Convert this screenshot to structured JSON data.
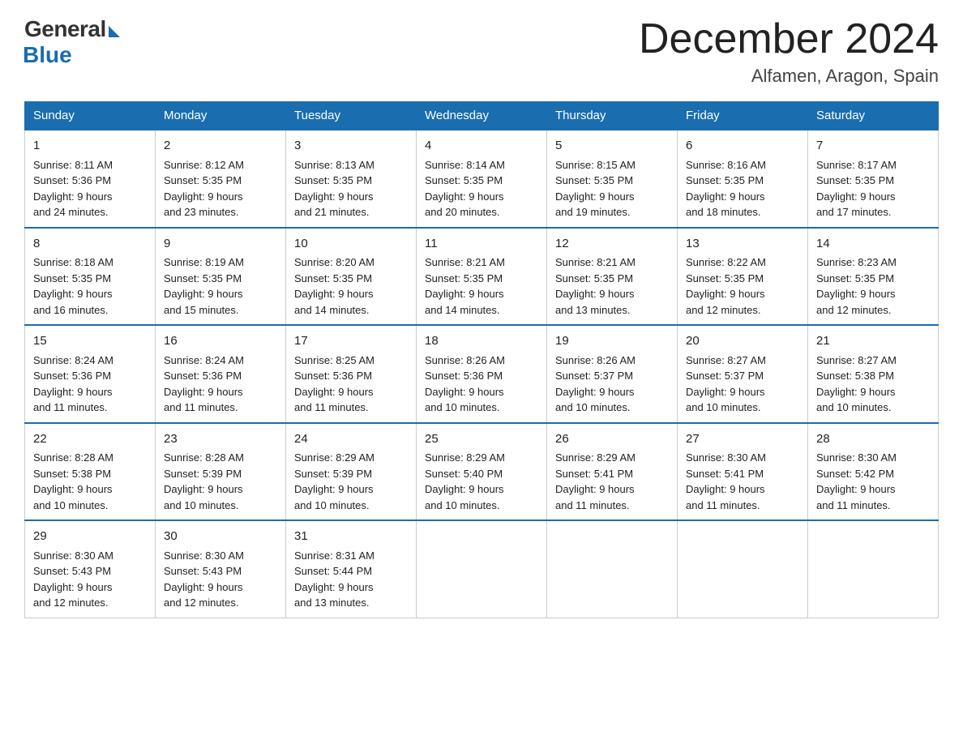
{
  "header": {
    "logo_general": "General",
    "logo_blue": "Blue",
    "month_title": "December 2024",
    "location": "Alfamen, Aragon, Spain"
  },
  "days_of_week": [
    "Sunday",
    "Monday",
    "Tuesday",
    "Wednesday",
    "Thursday",
    "Friday",
    "Saturday"
  ],
  "weeks": [
    [
      {
        "day": "1",
        "sunrise": "8:11 AM",
        "sunset": "5:36 PM",
        "daylight": "9 hours and 24 minutes."
      },
      {
        "day": "2",
        "sunrise": "8:12 AM",
        "sunset": "5:35 PM",
        "daylight": "9 hours and 23 minutes."
      },
      {
        "day": "3",
        "sunrise": "8:13 AM",
        "sunset": "5:35 PM",
        "daylight": "9 hours and 21 minutes."
      },
      {
        "day": "4",
        "sunrise": "8:14 AM",
        "sunset": "5:35 PM",
        "daylight": "9 hours and 20 minutes."
      },
      {
        "day": "5",
        "sunrise": "8:15 AM",
        "sunset": "5:35 PM",
        "daylight": "9 hours and 19 minutes."
      },
      {
        "day": "6",
        "sunrise": "8:16 AM",
        "sunset": "5:35 PM",
        "daylight": "9 hours and 18 minutes."
      },
      {
        "day": "7",
        "sunrise": "8:17 AM",
        "sunset": "5:35 PM",
        "daylight": "9 hours and 17 minutes."
      }
    ],
    [
      {
        "day": "8",
        "sunrise": "8:18 AM",
        "sunset": "5:35 PM",
        "daylight": "9 hours and 16 minutes."
      },
      {
        "day": "9",
        "sunrise": "8:19 AM",
        "sunset": "5:35 PM",
        "daylight": "9 hours and 15 minutes."
      },
      {
        "day": "10",
        "sunrise": "8:20 AM",
        "sunset": "5:35 PM",
        "daylight": "9 hours and 14 minutes."
      },
      {
        "day": "11",
        "sunrise": "8:21 AM",
        "sunset": "5:35 PM",
        "daylight": "9 hours and 14 minutes."
      },
      {
        "day": "12",
        "sunrise": "8:21 AM",
        "sunset": "5:35 PM",
        "daylight": "9 hours and 13 minutes."
      },
      {
        "day": "13",
        "sunrise": "8:22 AM",
        "sunset": "5:35 PM",
        "daylight": "9 hours and 12 minutes."
      },
      {
        "day": "14",
        "sunrise": "8:23 AM",
        "sunset": "5:35 PM",
        "daylight": "9 hours and 12 minutes."
      }
    ],
    [
      {
        "day": "15",
        "sunrise": "8:24 AM",
        "sunset": "5:36 PM",
        "daylight": "9 hours and 11 minutes."
      },
      {
        "day": "16",
        "sunrise": "8:24 AM",
        "sunset": "5:36 PM",
        "daylight": "9 hours and 11 minutes."
      },
      {
        "day": "17",
        "sunrise": "8:25 AM",
        "sunset": "5:36 PM",
        "daylight": "9 hours and 11 minutes."
      },
      {
        "day": "18",
        "sunrise": "8:26 AM",
        "sunset": "5:36 PM",
        "daylight": "9 hours and 10 minutes."
      },
      {
        "day": "19",
        "sunrise": "8:26 AM",
        "sunset": "5:37 PM",
        "daylight": "9 hours and 10 minutes."
      },
      {
        "day": "20",
        "sunrise": "8:27 AM",
        "sunset": "5:37 PM",
        "daylight": "9 hours and 10 minutes."
      },
      {
        "day": "21",
        "sunrise": "8:27 AM",
        "sunset": "5:38 PM",
        "daylight": "9 hours and 10 minutes."
      }
    ],
    [
      {
        "day": "22",
        "sunrise": "8:28 AM",
        "sunset": "5:38 PM",
        "daylight": "9 hours and 10 minutes."
      },
      {
        "day": "23",
        "sunrise": "8:28 AM",
        "sunset": "5:39 PM",
        "daylight": "9 hours and 10 minutes."
      },
      {
        "day": "24",
        "sunrise": "8:29 AM",
        "sunset": "5:39 PM",
        "daylight": "9 hours and 10 minutes."
      },
      {
        "day": "25",
        "sunrise": "8:29 AM",
        "sunset": "5:40 PM",
        "daylight": "9 hours and 10 minutes."
      },
      {
        "day": "26",
        "sunrise": "8:29 AM",
        "sunset": "5:41 PM",
        "daylight": "9 hours and 11 minutes."
      },
      {
        "day": "27",
        "sunrise": "8:30 AM",
        "sunset": "5:41 PM",
        "daylight": "9 hours and 11 minutes."
      },
      {
        "day": "28",
        "sunrise": "8:30 AM",
        "sunset": "5:42 PM",
        "daylight": "9 hours and 11 minutes."
      }
    ],
    [
      {
        "day": "29",
        "sunrise": "8:30 AM",
        "sunset": "5:43 PM",
        "daylight": "9 hours and 12 minutes."
      },
      {
        "day": "30",
        "sunrise": "8:30 AM",
        "sunset": "5:43 PM",
        "daylight": "9 hours and 12 minutes."
      },
      {
        "day": "31",
        "sunrise": "8:31 AM",
        "sunset": "5:44 PM",
        "daylight": "9 hours and 13 minutes."
      },
      null,
      null,
      null,
      null
    ]
  ],
  "labels": {
    "sunrise": "Sunrise:",
    "sunset": "Sunset:",
    "daylight": "Daylight:"
  }
}
